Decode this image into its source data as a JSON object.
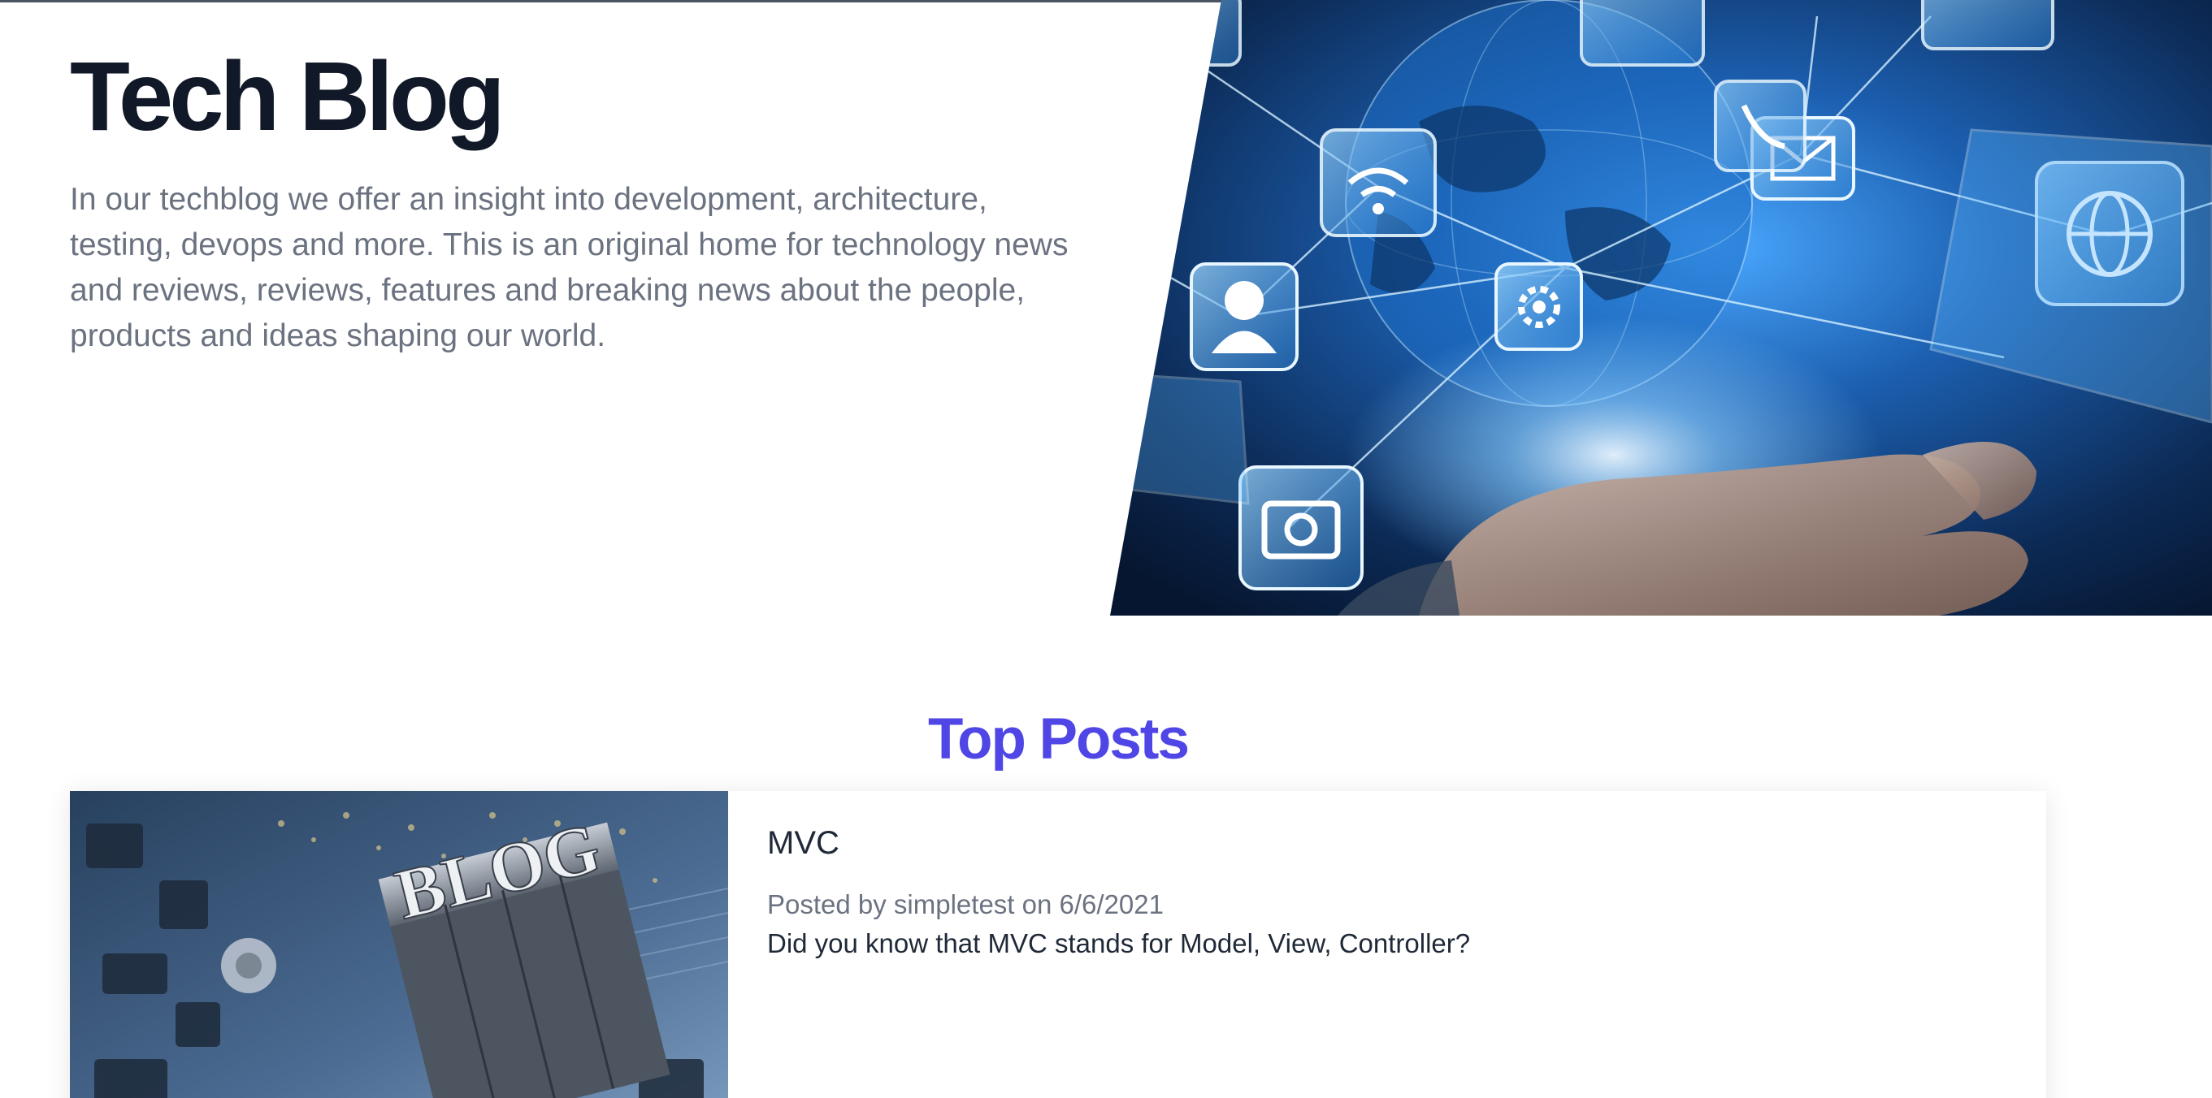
{
  "hero": {
    "title": "Tech Blog",
    "description": "In our techblog we offer an insight into development, architecture, testing, devops and more. This is an original home for technology news and reviews, reviews, features and breaking news about the people, products and ideas shaping our world.",
    "image_icon": "network-globe-hand-image"
  },
  "top_posts": {
    "title": "Top Posts",
    "accent_color": "#4f46e5",
    "posts": [
      {
        "title": "MVC",
        "meta": "Posted by simpletest on 6/6/2021",
        "excerpt": "Did you know that MVC stands for Model, View, Controller?",
        "thumbnail_text": "BLOG",
        "thumbnail_icon": "blog-letterpress-image"
      }
    ]
  },
  "colors": {
    "heading": "#111827",
    "muted_text": "#6b7280",
    "body_text": "#1f2937",
    "accent": "#4f46e5"
  }
}
